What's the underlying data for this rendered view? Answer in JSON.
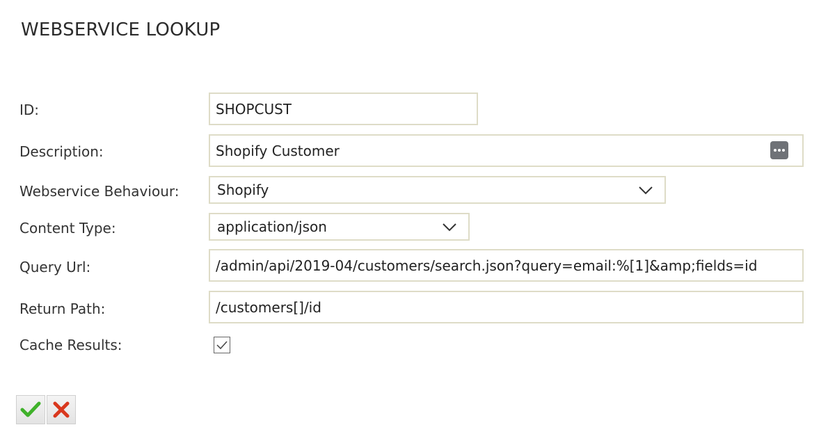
{
  "page": {
    "title": "WEBSERVICE LOOKUP"
  },
  "form": {
    "id": {
      "label": "ID:",
      "value": "SHOPCUST"
    },
    "description": {
      "label": "Description:",
      "value": "Shopify Customer",
      "icon": "ellipsis-icon"
    },
    "webservice_behaviour": {
      "label": "Webservice Behaviour:",
      "value": "Shopify"
    },
    "content_type": {
      "label": "Content Type:",
      "value": "application/json"
    },
    "query_url": {
      "label": "Query Url:",
      "value": "/admin/api/2019-04/customers/search.json?query=email:%[1]&amp;fields=id"
    },
    "return_path": {
      "label": "Return Path:",
      "value": "/customers[]/id"
    },
    "cache_results": {
      "label": "Cache Results:",
      "checked": true
    }
  },
  "actions": {
    "save_icon": "checkmark-icon",
    "cancel_icon": "cross-icon"
  },
  "colors": {
    "field_border": "#dedcc7",
    "save_green": "#3fb12a",
    "cancel_red": "#d9381e"
  }
}
